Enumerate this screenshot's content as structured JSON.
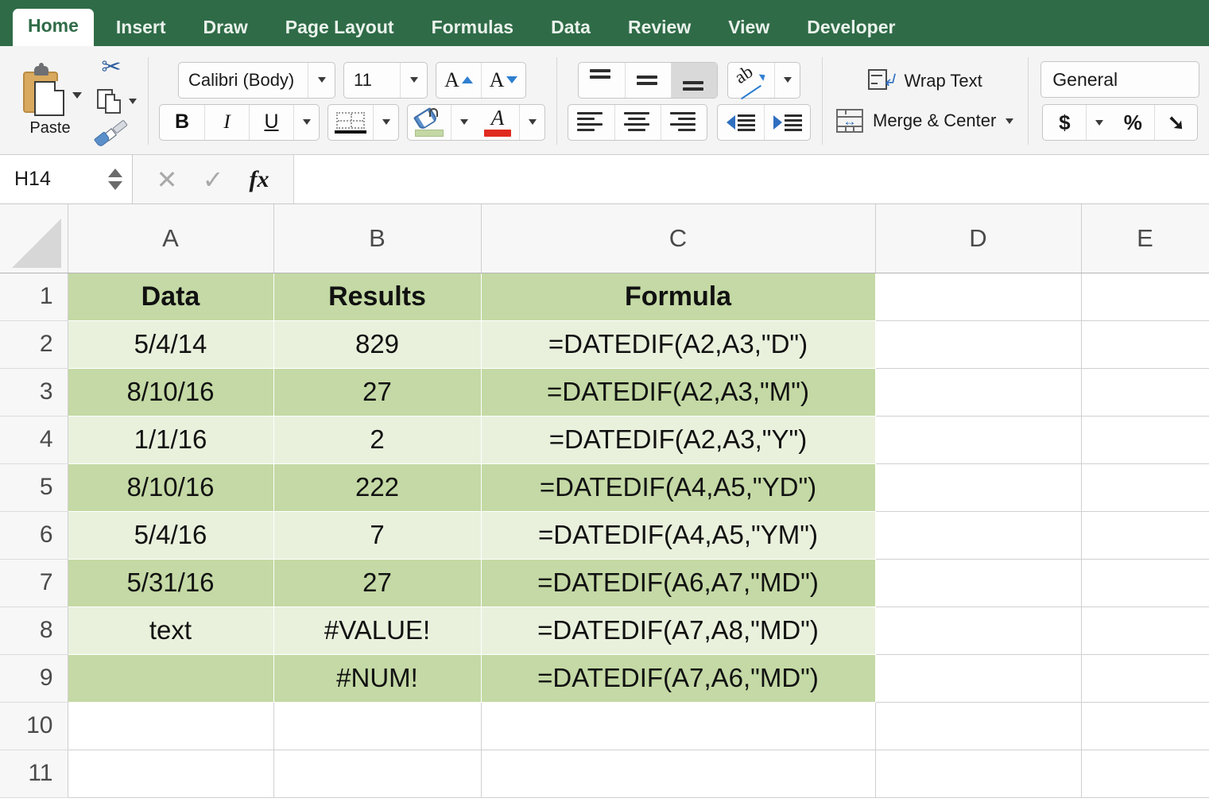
{
  "ribbon": {
    "tabs": [
      {
        "label": "Home",
        "active": true
      },
      {
        "label": "Insert",
        "active": false
      },
      {
        "label": "Draw",
        "active": false
      },
      {
        "label": "Page Layout",
        "active": false
      },
      {
        "label": "Formulas",
        "active": false
      },
      {
        "label": "Data",
        "active": false
      },
      {
        "label": "Review",
        "active": false
      },
      {
        "label": "View",
        "active": false
      },
      {
        "label": "Developer",
        "active": false
      }
    ],
    "clipboard": {
      "paste_label": "Paste",
      "cut_icon": "scissors-icon",
      "copy_icon": "copy-icon",
      "format_painter_icon": "format-painter-icon"
    },
    "font": {
      "font_name": "Calibri (Body)",
      "font_size": "11",
      "grow_font_icon": "grow-font-icon",
      "shrink_font_icon": "shrink-font-icon",
      "bold_label": "B",
      "italic_label": "I",
      "underline_label": "U",
      "borders_icon": "borders-icon",
      "fill_color_icon": "fill-color-icon",
      "fill_color": "#c3d8a4",
      "font_color_icon": "font-color-icon",
      "font_color": "#e02b20"
    },
    "alignment": {
      "top_align_icon": "align-top-icon",
      "middle_align_icon": "align-middle-icon",
      "bottom_align_icon": "align-bottom-icon",
      "orientation_icon": "text-orientation-icon",
      "align_left_icon": "align-left-icon",
      "align_center_icon": "align-center-icon",
      "align_right_icon": "align-right-icon",
      "decrease_indent_icon": "decrease-indent-icon",
      "increase_indent_icon": "increase-indent-icon",
      "wrap_text_label": "Wrap Text",
      "merge_center_label": "Merge & Center"
    },
    "number": {
      "format": "General",
      "currency_label": "$",
      "percent_label": "%",
      "comma_label": "➘"
    }
  },
  "formula_bar": {
    "name_box": "H14",
    "cancel_icon": "close-icon",
    "enter_icon": "check-icon",
    "function_icon": "fx-icon",
    "content": ""
  },
  "grid": {
    "column_headers": [
      "A",
      "B",
      "C",
      "D",
      "E"
    ],
    "row_headers": [
      "1",
      "2",
      "3",
      "4",
      "5",
      "6",
      "7",
      "8",
      "9",
      "10",
      "11"
    ],
    "rows": [
      {
        "num": "1",
        "band": "hdr",
        "a": "Data",
        "b": "Results",
        "c": "Formula",
        "filled": true
      },
      {
        "num": "2",
        "band": "light",
        "a": "5/4/14",
        "b": "829",
        "c": "=DATEDIF(A2,A3,\"D\")",
        "filled": true
      },
      {
        "num": "3",
        "band": "dark",
        "a": "8/10/16",
        "b": "27",
        "c": "=DATEDIF(A2,A3,\"M\")",
        "filled": true
      },
      {
        "num": "4",
        "band": "light",
        "a": "1/1/16",
        "b": "2",
        "c": "=DATEDIF(A2,A3,\"Y\")",
        "filled": true
      },
      {
        "num": "5",
        "band": "dark",
        "a": "8/10/16",
        "b": "222",
        "c": "=DATEDIF(A4,A5,\"YD\")",
        "filled": true
      },
      {
        "num": "6",
        "band": "light",
        "a": "5/4/16",
        "b": "7",
        "c": "=DATEDIF(A4,A5,\"YM\")",
        "filled": true
      },
      {
        "num": "7",
        "band": "dark",
        "a": "5/31/16",
        "b": "27",
        "c": "=DATEDIF(A6,A7,\"MD\")",
        "filled": true
      },
      {
        "num": "8",
        "band": "light",
        "a": "text",
        "b": "#VALUE!",
        "c": "=DATEDIF(A7,A8,\"MD\")",
        "filled": true
      },
      {
        "num": "9",
        "band": "dark",
        "a": "",
        "b": "#NUM!",
        "c": "=DATEDIF(A7,A6,\"MD\")",
        "filled": true
      },
      {
        "num": "10",
        "band": "none",
        "a": "",
        "b": "",
        "c": "",
        "filled": false
      },
      {
        "num": "11",
        "band": "none",
        "a": "",
        "b": "",
        "c": "",
        "filled": false
      }
    ]
  },
  "colors": {
    "ribbon_green": "#2f6b47",
    "band_dark": "#c4d9a5",
    "band_light": "#e9f1dd"
  }
}
